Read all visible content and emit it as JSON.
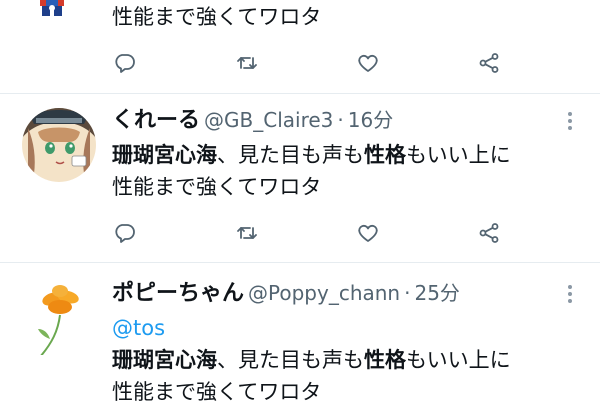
{
  "tweets": [
    {
      "text_line2": "性能まで強くてワロタ"
    },
    {
      "display_name": "くれーる",
      "handle": "@GB_Claire3",
      "time_sep": "·",
      "time": "16分",
      "text_parts": [
        "珊瑚宮心海",
        "、見た目も声も",
        "性格",
        "もいい上に"
      ],
      "text_line2": "性能まで強くてワロタ"
    },
    {
      "display_name": "ポピーちゃん",
      "handle": "@Poppy_chann",
      "time_sep": "·",
      "time": "25分",
      "mention": "@tos",
      "text_parts": [
        "珊瑚宮心海",
        "、見た目も声も",
        "性格",
        "もいい上に"
      ],
      "text_line2": "性能まで強くてワロタ"
    }
  ],
  "icons": {
    "reply": "reply-icon",
    "retweet": "retweet-icon",
    "like": "heart-icon",
    "share": "share-icon",
    "more": "more-icon"
  },
  "colors": {
    "text": "#0f1419",
    "secondary": "#536471",
    "link": "#1d9bf0",
    "icon": "#536471",
    "divider": "#e6ecf0"
  }
}
